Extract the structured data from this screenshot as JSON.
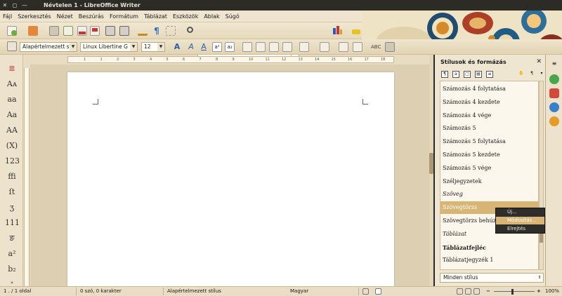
{
  "window": {
    "title": "Névtelen 1 - LibreOffice Writer"
  },
  "menu": [
    "Fájl",
    "Szerkesztés",
    "Nézet",
    "Beszúrás",
    "Formátum",
    "Táblázat",
    "Eszközök",
    "Ablak",
    "Súgó"
  ],
  "search": {
    "placeholder": "Keresés"
  },
  "format_bar": {
    "paragraph_style": "Alapértelmezett stí",
    "font_name": "Linux Libertine G",
    "font_size": "12"
  },
  "ruler": {
    "marks": [
      "1",
      "1",
      "2",
      "3",
      "4",
      "5",
      "6",
      "7",
      "8",
      "9",
      "10",
      "11",
      "12",
      "13",
      "14",
      "15",
      "16",
      "17",
      "18"
    ]
  },
  "left_toolbar": {
    "glyphs": [
      "Aᴀ",
      "aa",
      "Aa",
      "AA",
      "(X)",
      "123",
      "ffi",
      "ſt",
      "ʒ",
      "111",
      "ङ",
      "a²",
      "b₂"
    ]
  },
  "styles_panel": {
    "title": "Stílusok és formázás",
    "close_glyph": "✕",
    "items": [
      {
        "label": "Számozás 4 folytatása",
        "style": "normal"
      },
      {
        "label": "Számozás 4 kezdete",
        "style": "normal"
      },
      {
        "label": "Számozás 4 vége",
        "style": "normal"
      },
      {
        "label": "Számozás 5",
        "style": "normal"
      },
      {
        "label": "Számozás 5 folytatása",
        "style": "normal"
      },
      {
        "label": "Számozás 5 kezdete",
        "style": "normal"
      },
      {
        "label": "Számozás 5 vége",
        "style": "normal"
      },
      {
        "label": "Széljegyzetek",
        "style": "normal"
      },
      {
        "label": "Szöveg",
        "style": "italic"
      },
      {
        "label": "Szövegtörzs",
        "style": "selected"
      },
      {
        "label": "Szövegtörzs behúzás",
        "style": "normal"
      },
      {
        "label": "Táblázat",
        "style": "italic"
      },
      {
        "label": "Táblázatfejléc",
        "style": "bold"
      },
      {
        "label": "Táblázatjegyzék 1",
        "style": "normal"
      }
    ],
    "filter": "Minden stílus"
  },
  "context_menu": {
    "items": [
      {
        "label": "Új...",
        "highlighted": false
      },
      {
        "label": "Módosítás...",
        "highlighted": true
      },
      {
        "label": "Elrejtés",
        "highlighted": false
      }
    ]
  },
  "status": {
    "page": "1 . / 1 oldal",
    "words": "0 szó, 0 karakter",
    "page_style": "Alapértelmezett stílus",
    "language": "Magyar",
    "zoom": "100%"
  },
  "colors": {
    "accent": "#d8b574",
    "titlebar": "#2d2b26",
    "panel_border": "#2a2a2a"
  }
}
